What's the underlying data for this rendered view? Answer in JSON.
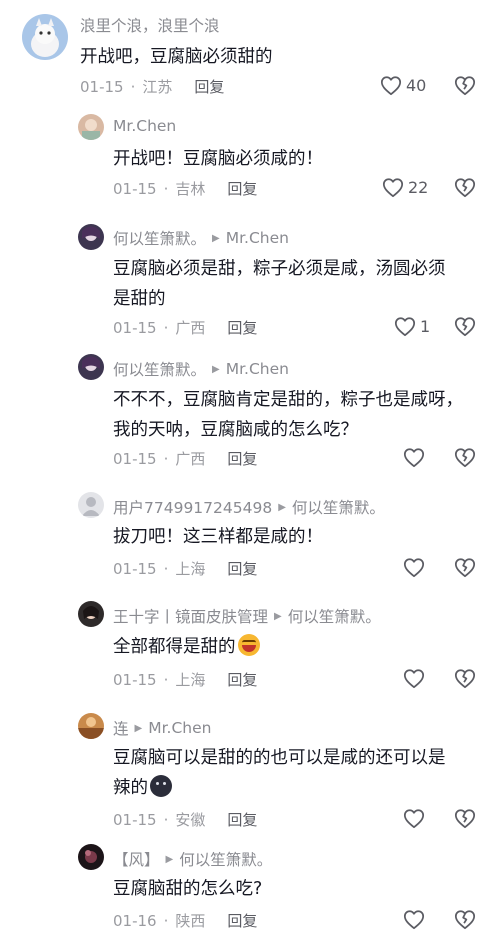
{
  "comments": [
    {
      "author": "浪里个浪，浪里个浪",
      "text": "开战吧，豆腐脑必须甜的",
      "date": "01-15",
      "location": "江苏",
      "reply_label": "回复",
      "likes": "40"
    },
    {
      "author": "Mr.Chen",
      "text": "开战吧！豆腐脑必须咸的！",
      "date": "01-15",
      "location": "吉林",
      "reply_label": "回复",
      "likes": "22"
    },
    {
      "author": "何以笙箫默。",
      "reply_to": "Mr.Chen",
      "text_line1": "豆腐脑必须是甜，粽子必须是咸，汤圆必须",
      "text_line2": "是甜的",
      "date": "01-15",
      "location": "广西",
      "reply_label": "回复",
      "likes": "1"
    },
    {
      "author": "何以笙箫默。",
      "reply_to": "Mr.Chen",
      "text_line1": "不不不，豆腐脑肯定是甜的，粽子也是咸呀，",
      "text_line2": "我的天呐，豆腐脑咸的怎么吃？",
      "date": "01-15",
      "location": "广西",
      "reply_label": "回复"
    },
    {
      "author": "用户7749917245498",
      "reply_to": "何以笙箫默。",
      "text": "拔刀吧！这三样都是咸的！",
      "date": "01-15",
      "location": "上海",
      "reply_label": "回复"
    },
    {
      "author": "王十字丨镜面皮肤管理",
      "reply_to": "何以笙箫默。",
      "text": "全部都得是甜的",
      "date": "01-15",
      "location": "上海",
      "reply_label": "回复"
    },
    {
      "author": "连",
      "reply_to": "Mr.Chen",
      "text_line1": "豆腐脑可以是甜的的也可以是咸的还可以是",
      "text_line2": "辣的",
      "date": "01-15",
      "location": "安徽",
      "reply_label": "回复"
    },
    {
      "author": "【风】",
      "reply_to": "何以笙箫默。",
      "text": "豆腐脑甜的怎么吃?",
      "date": "01-16",
      "location": "陕西",
      "reply_label": "回复"
    }
  ],
  "separator_dot": "·",
  "colors": {
    "text": "#161823",
    "secondary": "#8a8b91",
    "icon": "#5b5c63"
  }
}
